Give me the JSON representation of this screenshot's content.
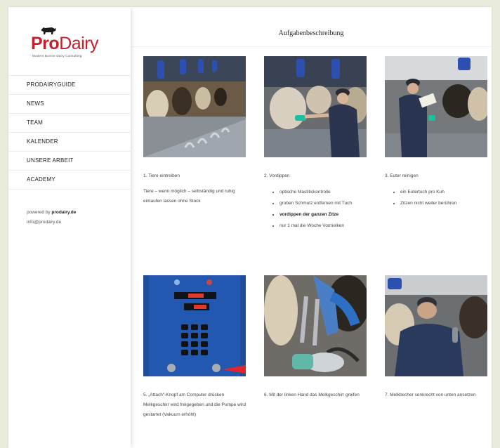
{
  "logo": {
    "brand_pro": "Pro",
    "brand_dairy": "Dairy",
    "tagline": "Modern Bovine Dairy Consulting"
  },
  "nav": [
    "PRODAIRYGUIDE",
    "NEWS",
    "TEAM",
    "KALENDER",
    "UNSERE ARBEIT",
    "ACADEMY"
  ],
  "powered": {
    "prefix": "powered by",
    "site": "prodairy.de",
    "email": "info@prodairy.de"
  },
  "page": {
    "title": "Aufgabenbeschreibung"
  },
  "steps": [
    {
      "title": "1. Tiere eintreiben",
      "body": "Tiere – wenn möglich – selbständig und ruhig eintaufen lassen ohne Stock"
    },
    {
      "title": "2. Vordippen",
      "bullets": [
        "optische Mastitiskontrolle",
        "groben Schmutz entfernen mit Tuch",
        "vordippen der ganzen Zitze",
        "nur 1 mal die Woche Vormelken"
      ]
    },
    {
      "title": "3. Euter reinigen",
      "bullets": [
        "ein Eutertuch pro Kuh",
        "Zitzen nicht weiter berühren"
      ]
    },
    {
      "title": "5. „Attach“-Knopf am Computer drücken",
      "body": "Melkgeschirr wird freigegeben und die Pumpe wird gestartet (Vakuum erhöht)"
    },
    {
      "title": "6. Mit der linken Hand das Melkgeschirr greifen",
      "body": ""
    },
    {
      "title": "7. Melkbecher senkrecht von unten ansetzen",
      "body": ""
    }
  ],
  "colors": {
    "brand_red": "#c61f2b",
    "page_bg": "#e9ebdc"
  }
}
